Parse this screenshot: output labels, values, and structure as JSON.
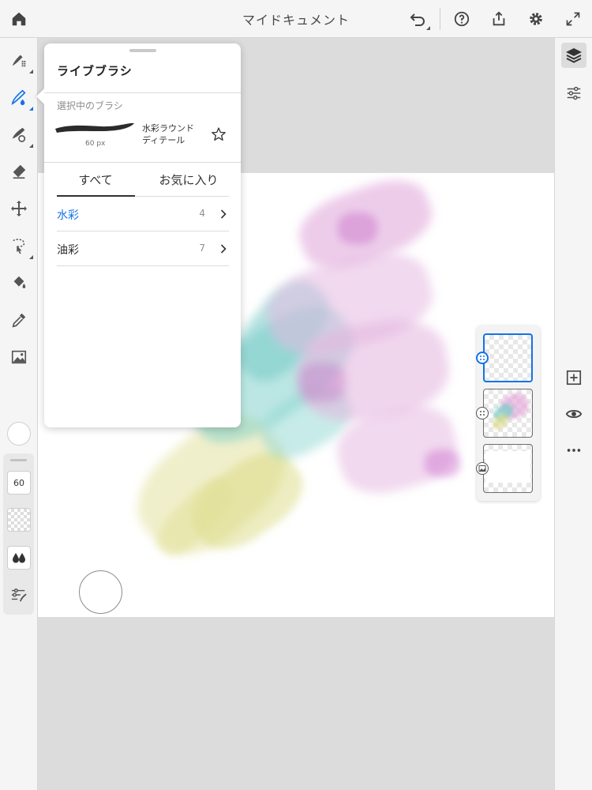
{
  "topbar": {
    "title": "マイドキュメント",
    "icons": [
      "home-icon",
      "undo-icon",
      "help-icon",
      "share-icon",
      "gear-icon",
      "expand-icon"
    ]
  },
  "left_toolbar": {
    "tools": [
      "pixel-brush",
      "live-brush",
      "vector-brush",
      "eraser",
      "transform",
      "selection",
      "fill",
      "eyedropper",
      "image"
    ],
    "active_tool": "live-brush",
    "brush_size": "60",
    "accent_color": "#1473e6"
  },
  "right_toolbar": {
    "icons": [
      "layers-icon",
      "properties-icon",
      "add-layer-icon",
      "visibility-icon",
      "more-icon"
    ]
  },
  "popover": {
    "title": "ライブブラシ",
    "selected_label": "選択中のブラシ",
    "brush_size": "60 px",
    "brush_name_line1": "水彩ラウンド",
    "brush_name_line2": "ディテール",
    "tabs": {
      "all": "すべて",
      "favorites": "お気に入り",
      "active": "all"
    },
    "categories": [
      {
        "label": "水彩",
        "count": "4",
        "active": true
      },
      {
        "label": "油彩",
        "count": "7",
        "active": false
      }
    ]
  },
  "layers": {
    "count": 3,
    "active_index": 0
  }
}
